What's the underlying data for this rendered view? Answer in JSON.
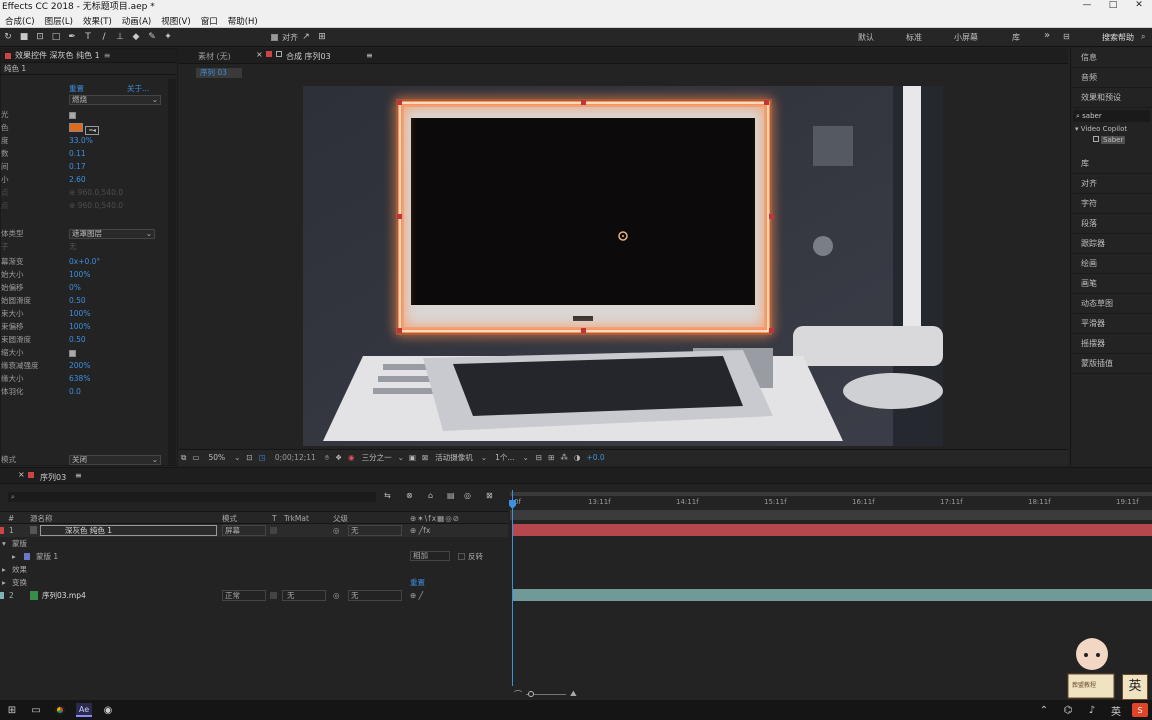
{
  "window": {
    "title": "Effects CC 2018 - 无标题项目.aep *",
    "minimize": "—",
    "maximize": "□",
    "close": "✕"
  },
  "menu": [
    "合成(C)",
    "图层(L)",
    "效果(T)",
    "动画(A)",
    "视图(V)",
    "窗口",
    "帮助(H)"
  ],
  "toolbar": {
    "snap_label": "对齐",
    "workspaces": [
      "默认",
      "标准",
      "小屏幕",
      "库"
    ],
    "more": "»",
    "search_help": "搜索帮助"
  },
  "effect_controls": {
    "tab": "效果控件 深灰色 纯色 1",
    "layer": "纯色 1",
    "fx_name": "重置",
    "about": "关于...",
    "preset": "燃烧",
    "props": [
      {
        "label": "光",
        "value": ""
      },
      {
        "label": "色",
        "value": ""
      },
      {
        "label": "度",
        "value": "33.0%"
      },
      {
        "label": "数",
        "value": "0.11"
      },
      {
        "label": "间",
        "value": "0.17"
      },
      {
        "label": "小",
        "value": "2.60"
      },
      {
        "label": "点",
        "value": "960.0,540.0"
      },
      {
        "label": "点",
        "value": "960.0,540.0"
      }
    ],
    "body_type_label": "体类型",
    "body_type": "遮罩图层",
    "sub_label": "子",
    "sub_value": "无",
    "props2": [
      {
        "label": "幕渐变",
        "value": "0x+0.0°"
      },
      {
        "label": "始大小",
        "value": "100%"
      },
      {
        "label": "始偏移",
        "value": "0%"
      },
      {
        "label": "始圆滑度",
        "value": "0.50"
      },
      {
        "label": "束大小",
        "value": "100%"
      },
      {
        "label": "束偏移",
        "value": "100%"
      },
      {
        "label": "束圆滑度",
        "value": "0.50"
      },
      {
        "label": "缩大小",
        "value": ""
      },
      {
        "label": "缘衰减强度",
        "value": "200%"
      },
      {
        "label": "缘大小",
        "value": "638%"
      },
      {
        "label": "体羽化",
        "value": "0.0"
      }
    ],
    "mode_label": "模式",
    "mode_value": "关闭"
  },
  "footage_tab": "素材 (无)",
  "comp_tab": "合成 序列03",
  "comp_sub": "序列 03",
  "viewer": {
    "zoom": "50%",
    "timecode": "0;00;12;11",
    "resolution": "三分之一",
    "camera": "活动摄像机",
    "views": "1个...",
    "exposure": "+0.0"
  },
  "right_panel": {
    "items": [
      "信息",
      "音频",
      "效果和预设"
    ],
    "search": "saber",
    "tree_parent": "Video Copilot",
    "tree_child": "Saber",
    "items2": [
      "库",
      "对齐",
      "字符",
      "段落",
      "跟踪器",
      "绘画",
      "画笔",
      "动态草图",
      "平滑器",
      "摇摆器",
      "蒙版插值"
    ]
  },
  "timeline": {
    "tab": "序列03",
    "headers": {
      "num": "#",
      "name": "源名称",
      "mode": "模式",
      "t": "T",
      "trkmat": "TrkMat",
      "parent": "父级"
    },
    "layer1": {
      "num": "1",
      "name": "深灰色 纯色 1",
      "mode": "屏幕",
      "parent": "无"
    },
    "mask_group": "蒙版",
    "mask1": "蒙版 1",
    "mask_mode": "相加",
    "inverted": "反转",
    "effects_group": "效果",
    "transform_group": "变换",
    "reset": "重置",
    "layer2": {
      "num": "2",
      "name": "序列03.mp4",
      "mode": "正常",
      "trkmat": "无",
      "parent": "无"
    },
    "ruler": [
      "0f",
      "13:11f",
      "14:11f",
      "15:11f",
      "16:11f",
      "17:11f",
      "18:11f",
      "19:11f"
    ]
  },
  "badge": {
    "logo_text": "葬盟教程",
    "ime": "英"
  },
  "tray": {
    "language": "英"
  }
}
